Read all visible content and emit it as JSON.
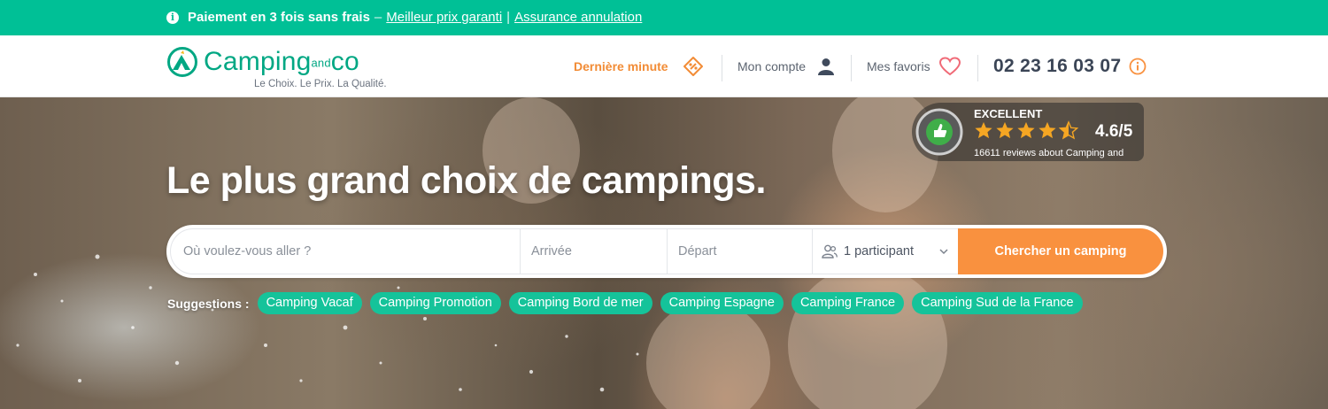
{
  "promo": {
    "bold_text": "Paiement en 3 fois sans frais",
    "dash": "–",
    "link1": "Meilleur prix garanti",
    "pipe": "|",
    "link2": "Assurance annulation"
  },
  "header": {
    "logo_word": "Camping",
    "logo_and": "and",
    "logo_co": "co",
    "tagline": "Le Choix. Le Prix. La Qualité.",
    "last_minute": "Dernière minute",
    "account": "Mon compte",
    "favorites": "Mes favoris",
    "phone": "02 23 16 03 07"
  },
  "hero": {
    "title": "Le plus grand choix de campings."
  },
  "review": {
    "rating_word": "EXCELLENT",
    "score": "4.6/5",
    "count_text": "16611 reviews about Camping and",
    "stars": 4.5
  },
  "search": {
    "where_placeholder": "Où voulez-vous aller ?",
    "arrival_placeholder": "Arrivée",
    "departure_placeholder": "Départ",
    "participants": "1 participant",
    "button": "Chercher un camping"
  },
  "suggestions": {
    "label": "Suggestions :",
    "items": [
      "Camping Vacaf",
      "Camping Promotion",
      "Camping Bord de mer",
      "Camping Espagne",
      "Camping France",
      "Camping Sud de la France"
    ]
  },
  "colors": {
    "brand_green": "#00c096",
    "accent_orange": "#f9913f",
    "chip_green": "#15c39a"
  },
  "icons": {
    "promo": "info-icon",
    "last_minute": "tag-discount-icon",
    "account": "user-icon",
    "favorites": "heart-icon",
    "phone": "info-circle-icon",
    "participants": "people-icon",
    "dropdown": "chevron-down-icon",
    "review_badge": "customer-award-badge-icon"
  }
}
